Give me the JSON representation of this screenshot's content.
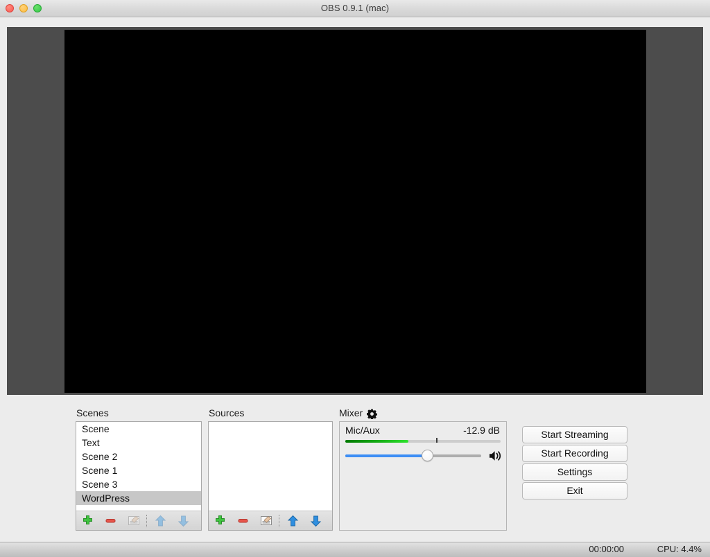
{
  "window": {
    "title": "OBS 0.9.1 (mac)",
    "traffic_lights": [
      {
        "name": "close",
        "color": "#f9564f"
      },
      {
        "name": "minimize",
        "color": "#fdbc40"
      },
      {
        "name": "maximize",
        "color": "#34c749"
      }
    ]
  },
  "preview": {
    "background_color": "#4c4c4c",
    "canvas_color": "#000000"
  },
  "scenes": {
    "label": "Scenes",
    "items": [
      {
        "label": "Scene",
        "selected": false
      },
      {
        "label": "Text",
        "selected": false
      },
      {
        "label": "Scene 2",
        "selected": false
      },
      {
        "label": "Scene 1",
        "selected": false
      },
      {
        "label": "Scene 3",
        "selected": false
      },
      {
        "label": "WordPress",
        "selected": true
      }
    ],
    "toolbar": [
      {
        "icon": "add-icon",
        "enabled": true
      },
      {
        "icon": "remove-icon",
        "enabled": true
      },
      {
        "icon": "properties-icon",
        "enabled": false
      },
      {
        "icon": "separator",
        "enabled": false
      },
      {
        "icon": "move-up-icon",
        "enabled": false
      },
      {
        "icon": "move-down-icon",
        "enabled": false
      }
    ]
  },
  "sources": {
    "label": "Sources",
    "items": [],
    "toolbar": [
      {
        "icon": "add-icon",
        "enabled": true
      },
      {
        "icon": "remove-icon",
        "enabled": true
      },
      {
        "icon": "properties-icon",
        "enabled": true
      },
      {
        "icon": "separator",
        "enabled": false
      },
      {
        "icon": "move-up-icon",
        "enabled": true
      },
      {
        "icon": "move-down-icon",
        "enabled": true
      }
    ]
  },
  "mixer": {
    "label": "Mixer",
    "settings_icon": "gear-icon",
    "channels": [
      {
        "name": "Mic/Aux",
        "level_db": "-12.9 dB",
        "meter_percent": 41,
        "meter_color": "#2ee32e",
        "volume_percent": 60,
        "volume_color": "#3d8ef5",
        "mute_icon": "speaker-icon"
      }
    ]
  },
  "controls": {
    "buttons": [
      {
        "label": "Start Streaming",
        "name": "start-streaming-button"
      },
      {
        "label": "Start Recording",
        "name": "start-recording-button"
      },
      {
        "label": "Settings",
        "name": "settings-button"
      },
      {
        "label": "Exit",
        "name": "exit-button"
      }
    ]
  },
  "status": {
    "timer": "00:00:00",
    "cpu": "CPU: 4.4%"
  }
}
